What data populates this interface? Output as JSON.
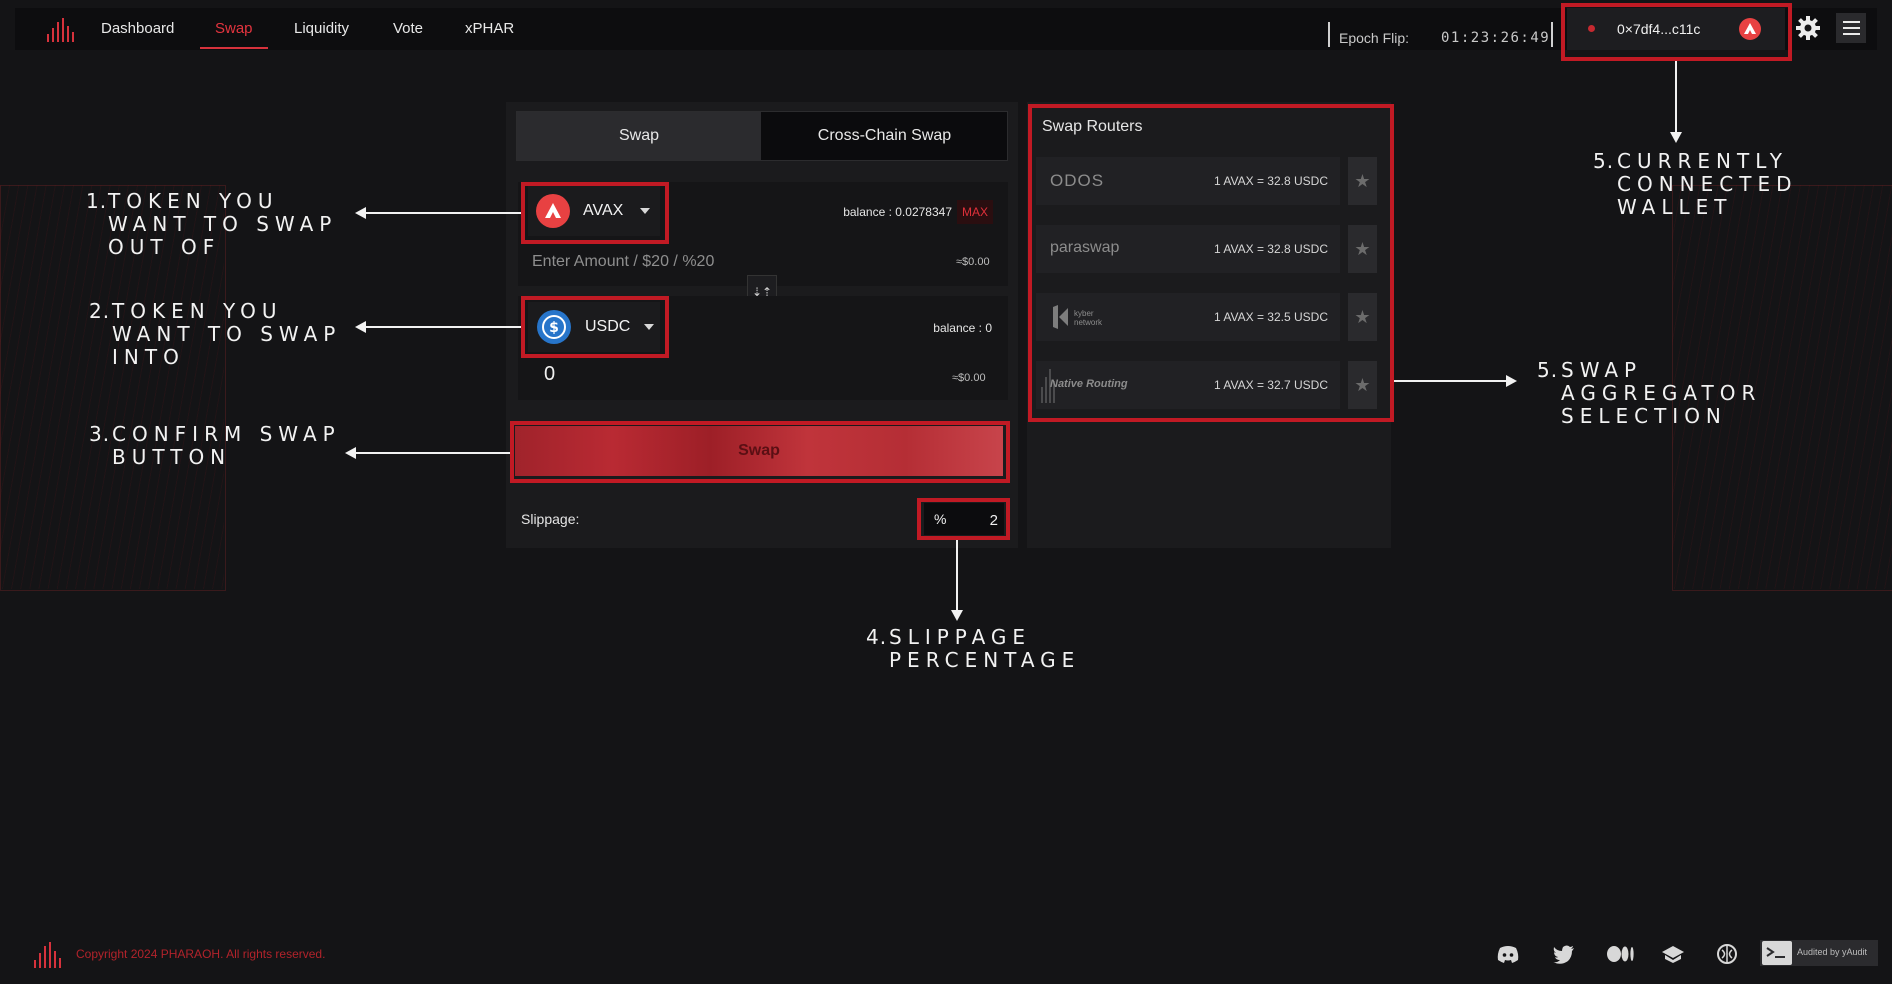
{
  "nav": {
    "items": [
      {
        "label": "Dashboard"
      },
      {
        "label": "Swap"
      },
      {
        "label": "Liquidity"
      },
      {
        "label": "Vote"
      },
      {
        "label": "xPHAR"
      }
    ],
    "active": "Swap"
  },
  "epoch": {
    "label": "Epoch Flip:",
    "time": "01:23:26:49"
  },
  "wallet": {
    "address": "0×7df4...c11c"
  },
  "swap_panel": {
    "tabs": [
      {
        "label": "Swap"
      },
      {
        "label": "Cross-Chain Swap"
      }
    ],
    "active_tab": "Swap",
    "from": {
      "token": "AVAX",
      "balance_label": "balance",
      "balance_value": ": 0.0278347",
      "max_label": "MAX",
      "amount_placeholder": "Enter Amount / $20 / %20",
      "usd_value": "≈$0.00"
    },
    "to": {
      "token": "USDC",
      "balance_label": "balance",
      "balance_value": ": 0",
      "amount": "0",
      "usd_value": "≈$0.00"
    },
    "swap_button": "Swap",
    "slippage_label": "Slippage:",
    "slippage_unit": "%",
    "slippage_value": "2"
  },
  "routers": {
    "title": "Swap Routers",
    "items": [
      {
        "name": "ODOS",
        "rate": "1 AVAX = 32.8 USDC"
      },
      {
        "name": "paraswap",
        "rate": "1 AVAX = 32.8 USDC"
      },
      {
        "name": "kyber network",
        "rate": "1 AVAX = 32.5 USDC"
      },
      {
        "name": "Native Routing",
        "rate": "1 AVAX = 32.7 USDC"
      }
    ]
  },
  "annotations": {
    "a1": {
      "num": "1.",
      "text": "TOKEN YOU\nWANT TO SWAP\nOUT OF"
    },
    "a2": {
      "num": "2.",
      "text": "TOKEN YOU\nWANT TO SWAP\nINTO"
    },
    "a3": {
      "num": "3.",
      "text": "CONFIRM SWAP\nBUTTON"
    },
    "a4": {
      "num": "4.",
      "text": "SLIPPAGE\nPERCENTAGE"
    },
    "a5w": {
      "num": "5.",
      "text": "CURRENTLY\nCONNECTED\nWALLET"
    },
    "a5r": {
      "num": "5.",
      "text": "SWAP\nAGGREGATOR\nSELECTION"
    }
  },
  "footer": {
    "copyright": "Copyright 2024 PHARAOH. All rights reserved.",
    "audit_label": "Audited by yAudit",
    "social_icons": [
      "discord-icon",
      "twitter-icon",
      "medium-icon",
      "docs-icon",
      "brain-icon"
    ]
  },
  "colors": {
    "accent": "#d6323c",
    "highlight": "#c11a24",
    "background": "#141416",
    "panel": "#1b1b1d"
  }
}
